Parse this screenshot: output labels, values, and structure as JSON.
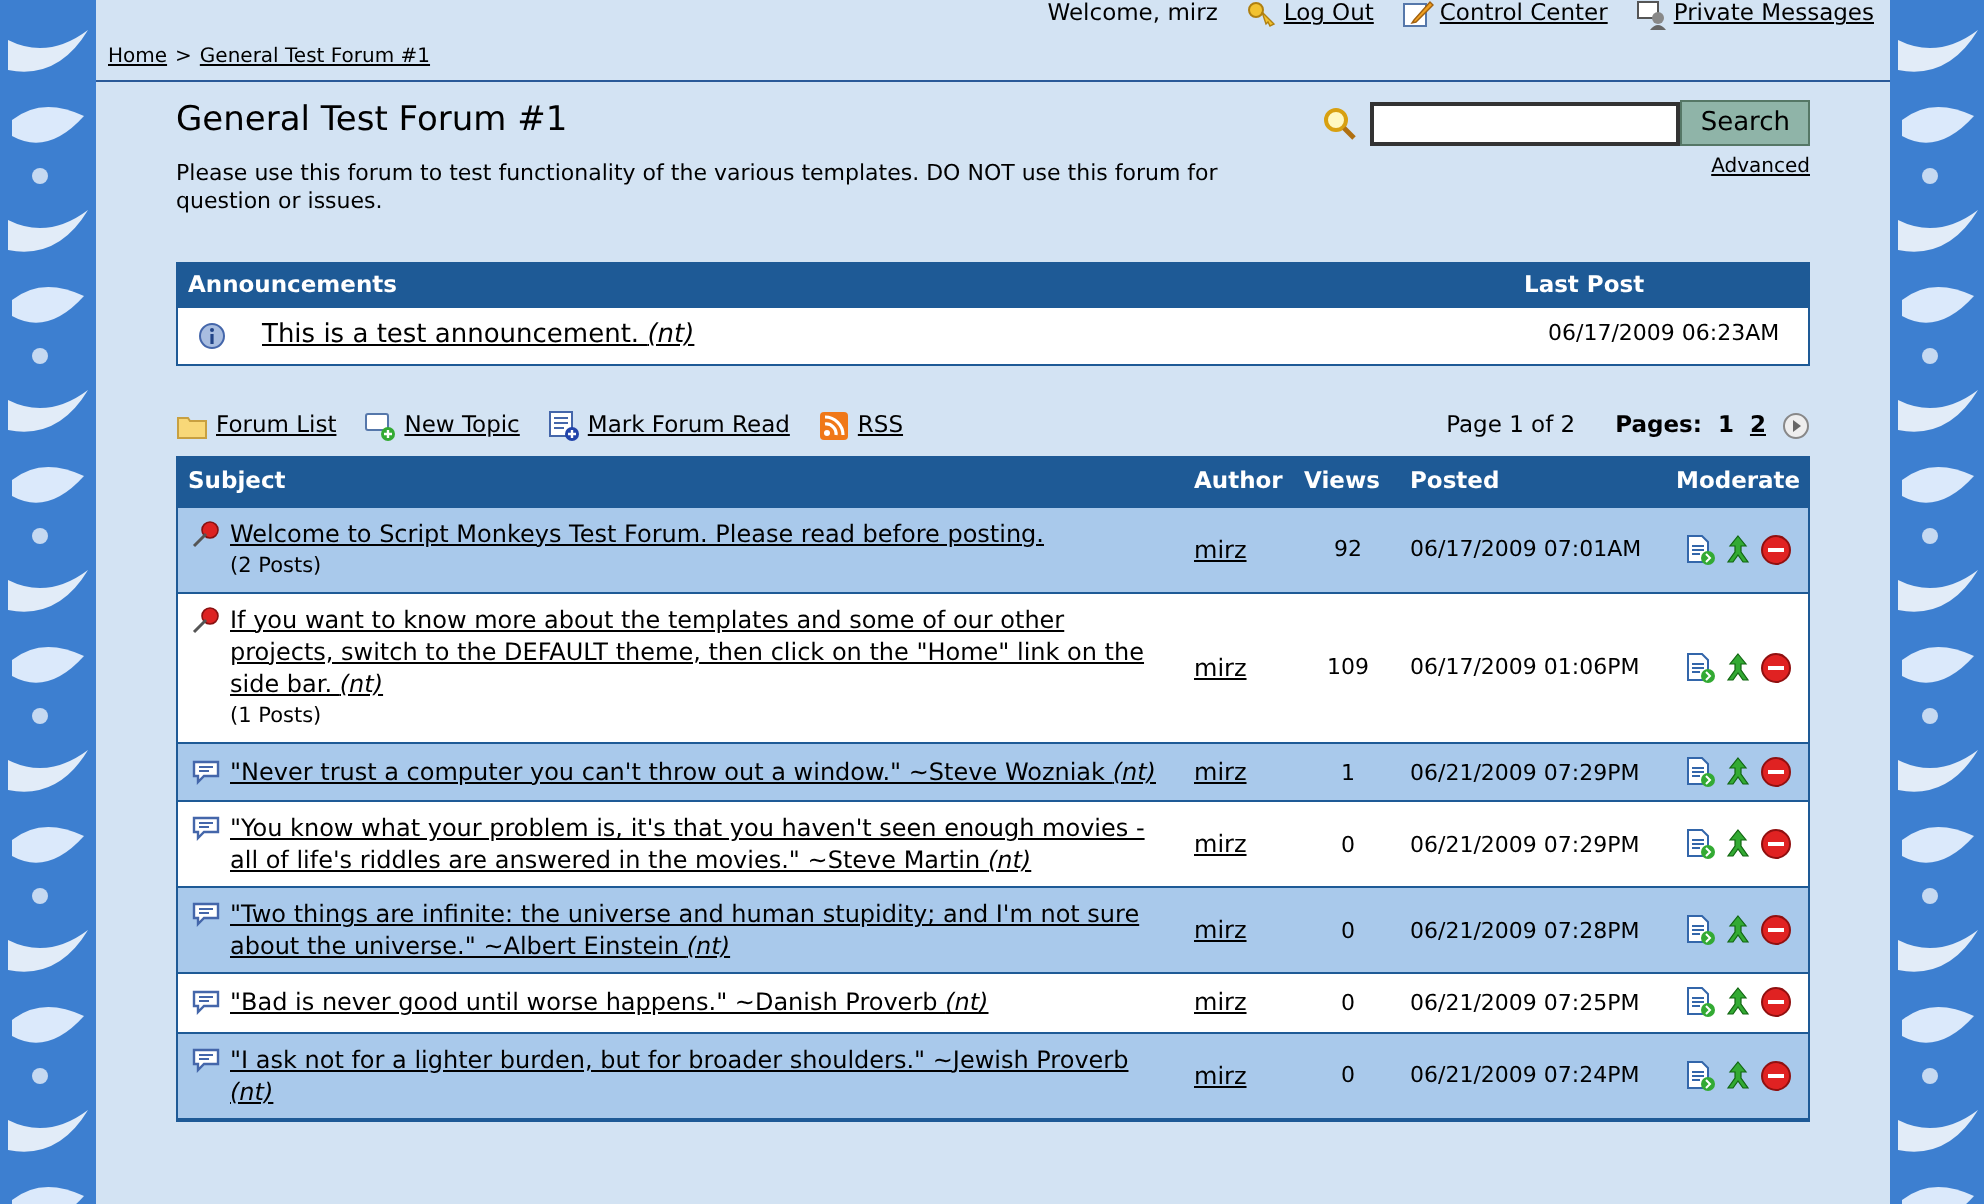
{
  "top_bar": {
    "welcome": "Welcome, mirz",
    "links": [
      {
        "label": "Log Out"
      },
      {
        "label": "Control Center"
      },
      {
        "label": "Private Messages"
      }
    ]
  },
  "breadcrumb": [
    {
      "label": "Home"
    },
    {
      "label": ">",
      "kind": "separator"
    },
    {
      "label": "General Test Forum #1"
    }
  ],
  "forum": {
    "title": "General Test Forum #1",
    "description": "Please use this forum to test functionality of the various templates. DO NOT use this forum for question or issues."
  },
  "search": {
    "button": "Search",
    "advanced": "Advanced"
  },
  "announcements": {
    "columns": [
      "Announcements",
      "Last Post"
    ],
    "rows": [
      {
        "title": "This is a test announcement. *(nt)*",
        "last_post": "06/17/2009 06:23AM"
      }
    ]
  },
  "toolbar": [
    {
      "label": "Forum List"
    },
    {
      "label": "New Topic"
    },
    {
      "label": "Mark Forum Read"
    },
    {
      "label": "RSS"
    }
  ],
  "pagination": {
    "summary": "Page 1 of 2",
    "label": "Pages:",
    "pages": [
      {
        "label": "1",
        "selected": true
      },
      {
        "label": "2",
        "selected": false
      }
    ]
  },
  "topics": {
    "columns": [
      "Subject",
      "Author",
      "Views",
      "Posted",
      "Moderate"
    ],
    "rows": [
      {
        "kind": "sticky",
        "subject": "Welcome to Script Monkeys Test Forum. Please read before posting.",
        "posts": "(2 Posts)",
        "author": "mirz",
        "views": "92",
        "posted": "06/17/2009 07:01AM"
      },
      {
        "kind": "sticky",
        "subject": "If you want to know more about the templates and some of our other projects, switch to the DEFAULT theme, then click on the \"Home\" link on the side bar. *(nt)*",
        "posts": "(1 Posts)",
        "author": "mirz",
        "views": "109",
        "posted": "06/17/2009 01:06PM"
      },
      {
        "kind": "normal",
        "subject": "\"Never trust a computer you can't throw out a window.\" ~Steve Wozniak *(nt)*",
        "author": "mirz",
        "views": "1",
        "posted": "06/21/2009 07:29PM"
      },
      {
        "kind": "normal",
        "subject": "\"You know what your problem is, it's that you haven't seen enough movies - all of life's riddles are answered in the movies.\" ~Steve Martin *(nt)*",
        "author": "mirz",
        "views": "0",
        "posted": "06/21/2009 07:29PM"
      },
      {
        "kind": "normal",
        "subject": "\"Two things are infinite: the universe and human stupidity; and I'm not sure about the universe.\" ~Albert Einstein *(nt)*",
        "author": "mirz",
        "views": "0",
        "posted": "06/21/2009 07:28PM"
      },
      {
        "kind": "normal",
        "subject": "\"Bad is never good until worse happens.\" ~Danish Proverb *(nt)*",
        "author": "mirz",
        "views": "0",
        "posted": "06/21/2009 07:25PM"
      },
      {
        "kind": "normal",
        "subject": "\"I ask not for a lighter burden, but for broader shoulders.\" ~Jewish Proverb *(nt)*",
        "author": "mirz",
        "views": "0",
        "posted": "06/21/2009 07:24PM"
      }
    ]
  }
}
